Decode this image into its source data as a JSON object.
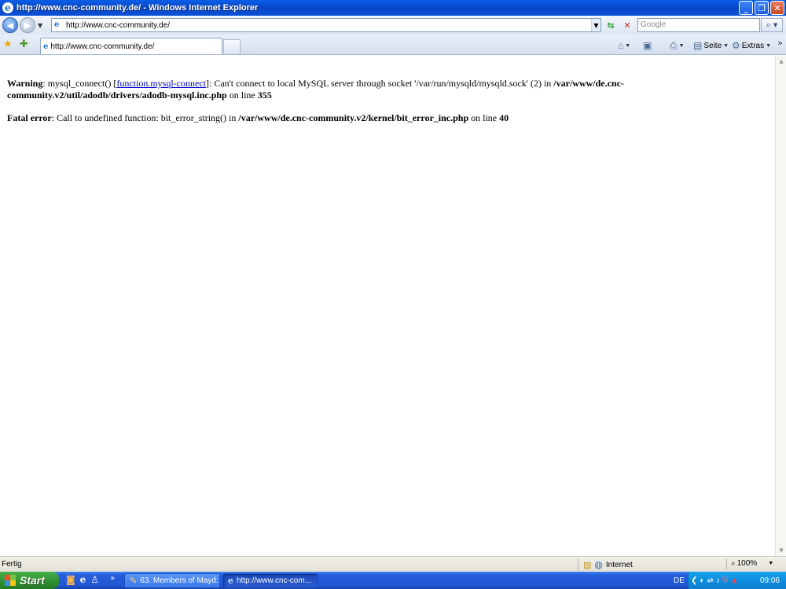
{
  "window": {
    "title": "http://www.cnc-community.de/ - Windows Internet Explorer",
    "minimize_icon": "minimize-icon",
    "restore_icon": "restore-icon",
    "close_icon": "close-icon"
  },
  "addressbar": {
    "url": "http://www.cnc-community.de/"
  },
  "search": {
    "placeholder": "Google"
  },
  "tabs": [
    {
      "label": "http://www.cnc-community.de/",
      "active": true
    }
  ],
  "commandbar": {
    "page_label": "Seite",
    "tools_label": "Extras"
  },
  "content": {
    "warning": {
      "label": "Warning",
      "text1": ": mysql_connect() [",
      "link": "function.mysql-connect",
      "text2": "]: Can't connect to local MySQL server through socket '/var/run/mysqld/mysqld.sock' (2) in ",
      "path": "/var/www/de.cnc-community.v2/util/adodb/drivers/adodb-mysql.inc.php",
      "text3": " on line ",
      "line": "355"
    },
    "fatal": {
      "label": "Fatal error",
      "text1": ": Call to undefined function: bit_error_string() in ",
      "path": "/var/www/de.cnc-community.v2/kernel/bit_error_inc.php",
      "text2": " on line ",
      "line": "40"
    }
  },
  "statusbar": {
    "status": "Fertig",
    "zone": "Internet",
    "zoom": "100%"
  },
  "taskbar": {
    "start_label": "Start",
    "tasks": [
      {
        "label": "63. Members of Mayd...",
        "active": false
      },
      {
        "label": "http://www.cnc-com...",
        "active": true
      }
    ],
    "language": "DE",
    "clock": "09:06"
  },
  "colors": {
    "titlebar": "#0646c5",
    "link": "#0000cc",
    "start_button": "#2f8f31",
    "taskbar": "#2157d4"
  }
}
